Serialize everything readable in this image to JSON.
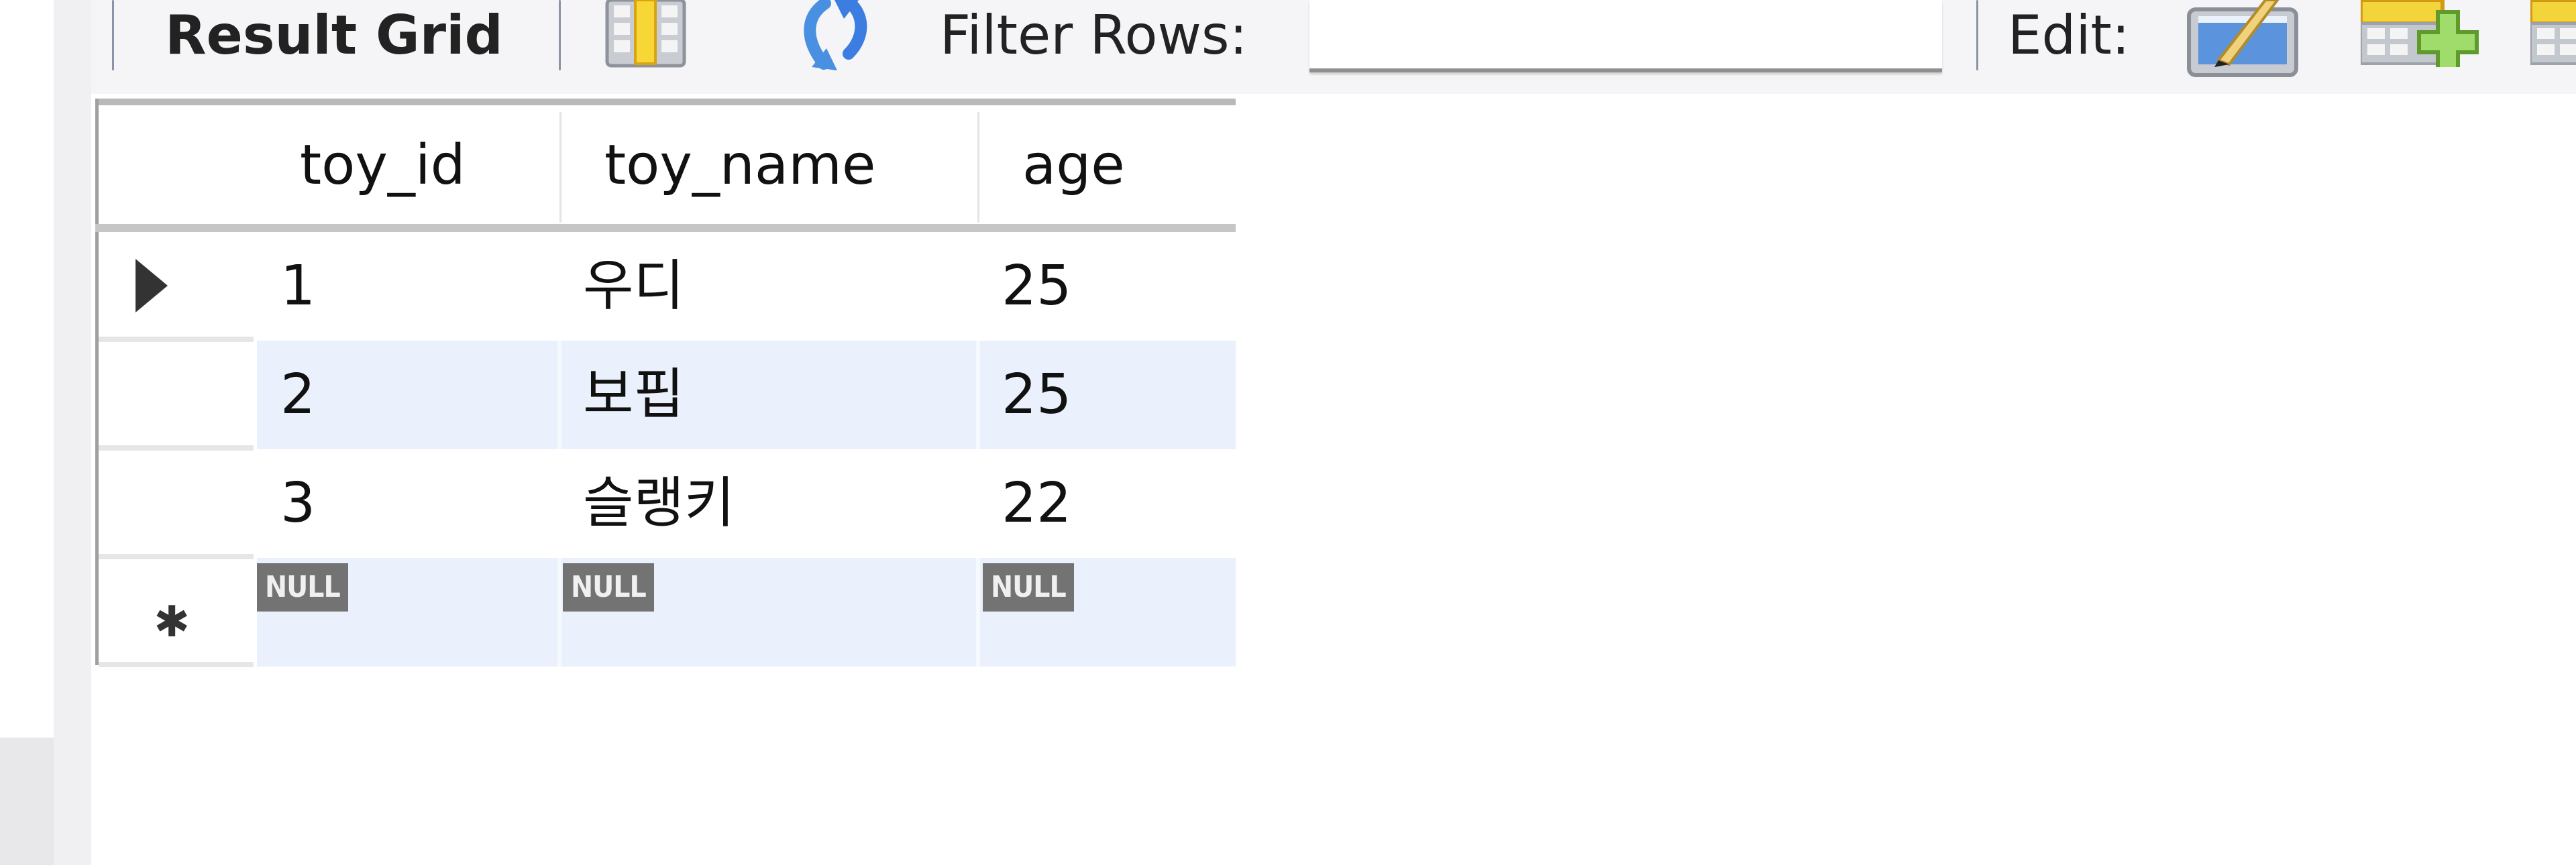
{
  "toolbar": {
    "result_grid_label": "Result Grid",
    "filter_rows_label": "Filter Rows:",
    "filter_rows_value": "",
    "edit_label": "Edit:",
    "icons": {
      "column_toggle": "column-toggle-icon",
      "refresh": "refresh-icon",
      "edit": "edit-row-icon",
      "add_row": "add-row-icon",
      "delete_row": "delete-row-icon"
    }
  },
  "grid": {
    "columns": [
      "toy_id",
      "toy_name",
      "age"
    ],
    "rows": [
      {
        "toy_id": "1",
        "toy_name": "우디",
        "age": "25",
        "current": true
      },
      {
        "toy_id": "2",
        "toy_name": "보핍",
        "age": "25",
        "current": false
      },
      {
        "toy_id": "3",
        "toy_name": "슬랭키",
        "age": "22",
        "current": false
      }
    ],
    "new_row": {
      "toy_id": "NULL",
      "toy_name": "NULL",
      "age": "NULL"
    },
    "row_indicator_current": "current-row-arrow",
    "row_indicator_new": "new-row-asterisk",
    "alt_row_color": "#eaf1fc",
    "null_badge_color": "#737373"
  }
}
